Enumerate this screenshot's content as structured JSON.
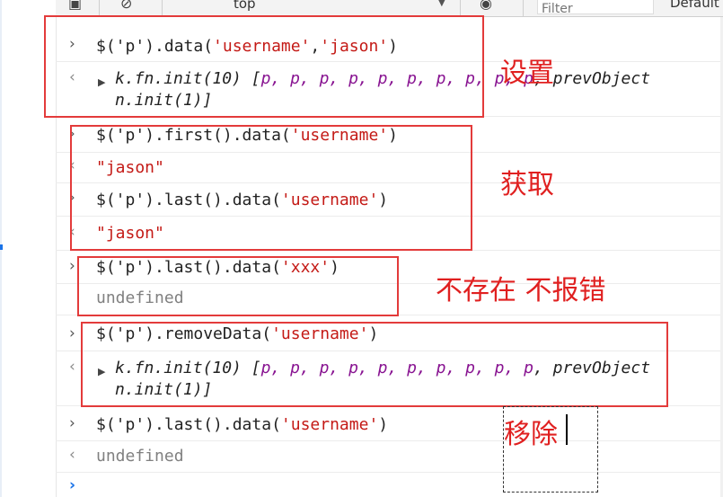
{
  "toolbar": {
    "execution_context": "top",
    "filter_placeholder": "Filter",
    "levels_label": "Default levels"
  },
  "console": {
    "entries": [
      {
        "kind": "input",
        "parts": [
          "$('p').data(",
          "'username'",
          ",",
          "'jason'",
          ")"
        ]
      },
      {
        "kind": "output-object",
        "line1": "k.fn.init(10) [",
        "items": "p, p, p, p, p, p, p, p, p, p",
        "tail": ", prevObject",
        "line2": "n.init(1)]"
      },
      {
        "kind": "input",
        "parts": [
          "$('p').first().data(",
          "'username'",
          ")"
        ]
      },
      {
        "kind": "output-string",
        "value": "\"jason\""
      },
      {
        "kind": "input",
        "parts": [
          "$('p').last().data(",
          "'username'",
          ")"
        ]
      },
      {
        "kind": "output-string",
        "value": "\"jason\""
      },
      {
        "kind": "input",
        "parts": [
          "$('p').last().data(",
          "'xxx'",
          ")"
        ]
      },
      {
        "kind": "output-undefined",
        "value": "undefined"
      },
      {
        "kind": "input",
        "parts": [
          "$('p').removeData(",
          "'username'",
          ")"
        ]
      },
      {
        "kind": "output-object",
        "line1": "k.fn.init(10) [",
        "items": "p, p, p, p, p, p, p, p, p, p",
        "tail": ", prevObject",
        "line2": "n.init(1)]"
      },
      {
        "kind": "input",
        "parts": [
          "$('p').last().data(",
          "'username'",
          ")"
        ]
      },
      {
        "kind": "output-undefined",
        "value": "undefined"
      }
    ]
  },
  "annotations": {
    "set": "设置",
    "get": "获取",
    "missing": "不存在 不报错",
    "remove": "移除"
  },
  "colors": {
    "annotation_red": "#e02020",
    "string_red": "#c41a16",
    "prompt_blue": "#1a73e8",
    "dom_purple": "#881391"
  }
}
